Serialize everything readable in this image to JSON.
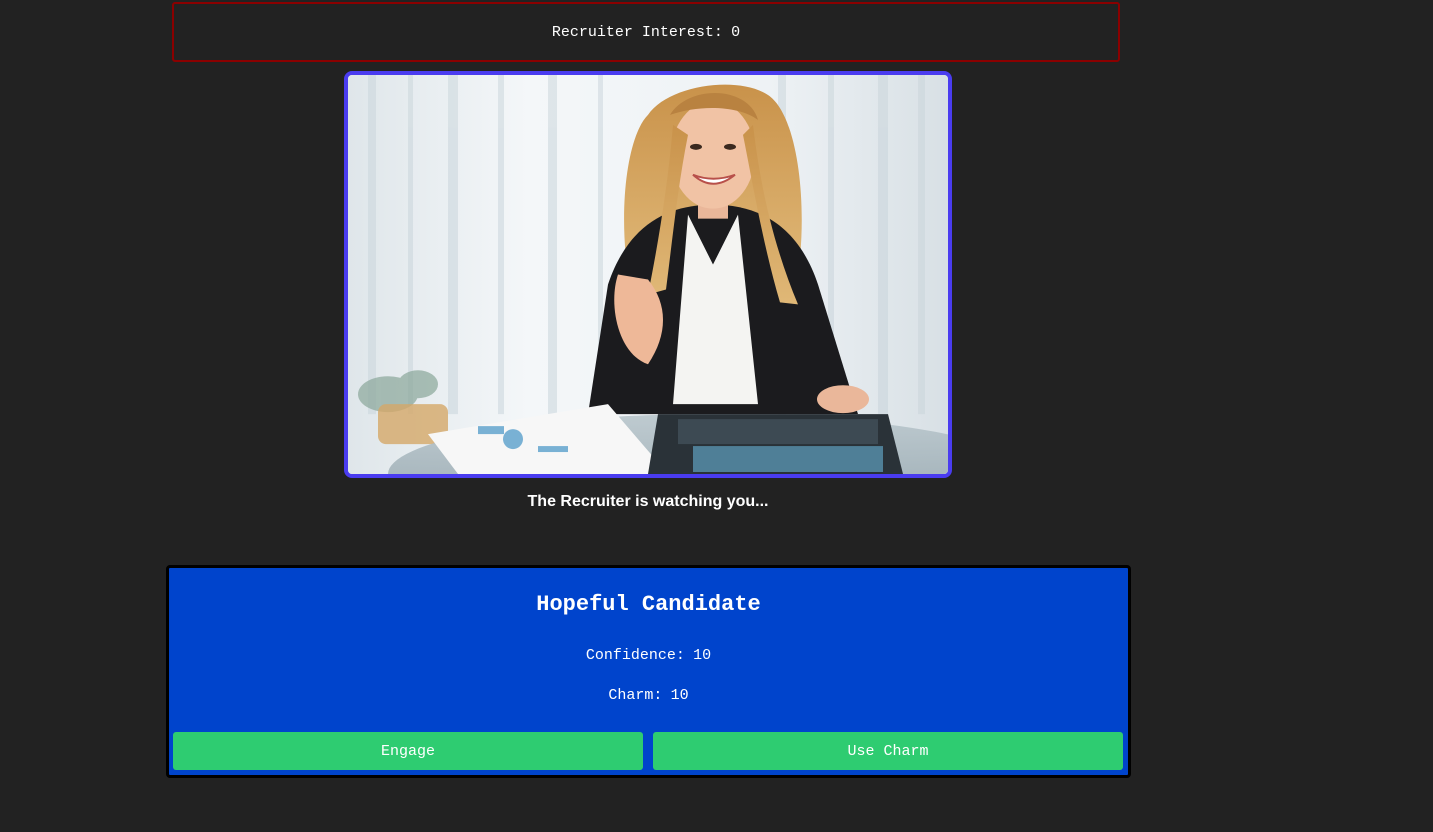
{
  "recruiter_interest": {
    "label": "Recruiter Interest:",
    "value": "0"
  },
  "recruiter": {
    "caption": "The Recruiter is watching you..."
  },
  "candidate": {
    "name": "Hopeful Candidate",
    "confidence_label": "Confidence:",
    "confidence_value": "10",
    "charm_label": "Charm:",
    "charm_value": "10"
  },
  "actions": {
    "engage_label": "Engage",
    "use_charm_label": "Use Charm"
  },
  "colors": {
    "background": "#222222",
    "interest_border": "#8b0000",
    "image_border": "#4a3cf0",
    "candidate_panel": "#0044cc",
    "button": "#2ecc71"
  }
}
